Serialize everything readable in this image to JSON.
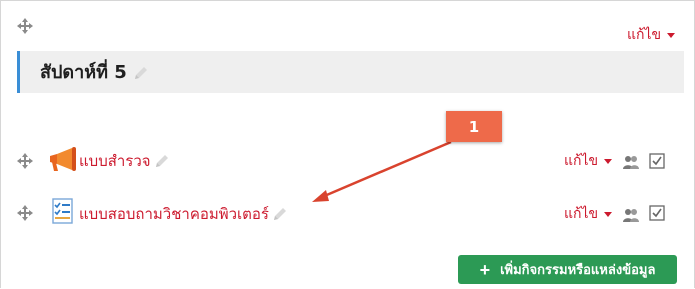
{
  "section": {
    "edit_label": "แก้ไข",
    "title": "สัปดาห์ที่ 5"
  },
  "activities": [
    {
      "name": "แบบสำรวจ",
      "edit_label": "แก้ไข",
      "icon": "megaphone-icon"
    },
    {
      "name": "แบบสอบถามวิชาคอมพิวเตอร์",
      "edit_label": "แก้ไข",
      "icon": "questionnaire-icon"
    }
  ],
  "add_button": {
    "label": "เพิ่มกิจกรรมหรือแหล่งข้อมูล"
  },
  "callout": {
    "number": "1"
  },
  "colors": {
    "link": "#cc1a2e",
    "accent": "#3a8ed6",
    "button": "#2c9a55",
    "callout": "#ee6a4a"
  }
}
